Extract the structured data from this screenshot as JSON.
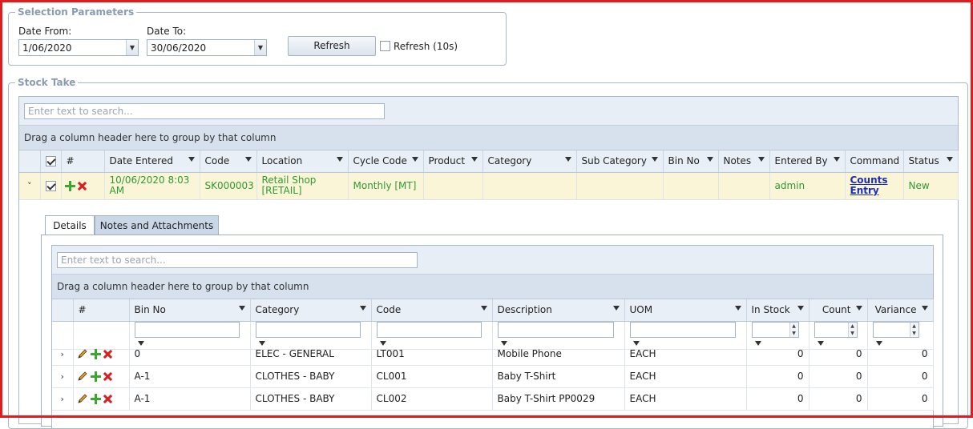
{
  "selection": {
    "legend": "Selection Parameters",
    "date_from_label": "Date From:",
    "date_from_value": "1/06/2020",
    "date_to_label": "Date To:",
    "date_to_value": "30/06/2020",
    "refresh_label": "Refresh",
    "auto_refresh_label": "Refresh (10s)",
    "auto_refresh_checked": false
  },
  "stock_take": {
    "legend": "Stock Take",
    "search_placeholder": "Enter text to search...",
    "group_hint": "Drag a column header here to group by that column",
    "columns": [
      "#",
      "Date Entered",
      "Code",
      "Location",
      "Cycle Code",
      "Product",
      "Category",
      "Sub Category",
      "Bin No",
      "Notes",
      "Entered By",
      "Command",
      "Status"
    ],
    "row": {
      "date_entered": "10/06/2020 8:03 AM",
      "code": "SK000003",
      "location": "Retail Shop [RETAIL]",
      "cycle_code": "Monthly [MT]",
      "product": "",
      "category": "",
      "sub_category": "",
      "bin_no": "",
      "notes": "",
      "entered_by": "admin",
      "command": "Counts Entry",
      "status": "New"
    }
  },
  "detail": {
    "tabs": [
      "Details",
      "Notes and Attachments"
    ],
    "search_placeholder": "Enter text to search...",
    "group_hint": "Drag a column header here to group by that column",
    "columns": [
      "#",
      "Bin No",
      "Category",
      "Code",
      "Description",
      "UOM",
      "In Stock",
      "Count",
      "Variance"
    ],
    "rows": [
      {
        "bin_no": "0",
        "category": "ELEC - GENERAL",
        "code": "LT001",
        "description": "Mobile Phone",
        "uom": "EACH",
        "in_stock": "0",
        "count": "0",
        "variance": "0"
      },
      {
        "bin_no": "A-1",
        "category": "CLOTHES - BABY",
        "code": "CL001",
        "description": "Baby T-Shirt",
        "uom": "EACH",
        "in_stock": "0",
        "count": "0",
        "variance": "0"
      },
      {
        "bin_no": "A-1",
        "category": "CLOTHES - BABY",
        "code": "CL002",
        "description": "Baby T-Shirt PP0029",
        "uom": "EACH",
        "in_stock": "0",
        "count": "0",
        "variance": "0"
      }
    ]
  },
  "colors": {
    "frame": "#e01c1c",
    "master_row_bg": "#fbf5d8",
    "master_row_text": "#2f9a2f",
    "link": "#1a2fb5",
    "header_bg": "#e9eff6"
  },
  "icons": [
    "chevron-down-icon",
    "add-icon",
    "delete-icon",
    "edit-icon",
    "filter-icon",
    "expand-icon"
  ]
}
